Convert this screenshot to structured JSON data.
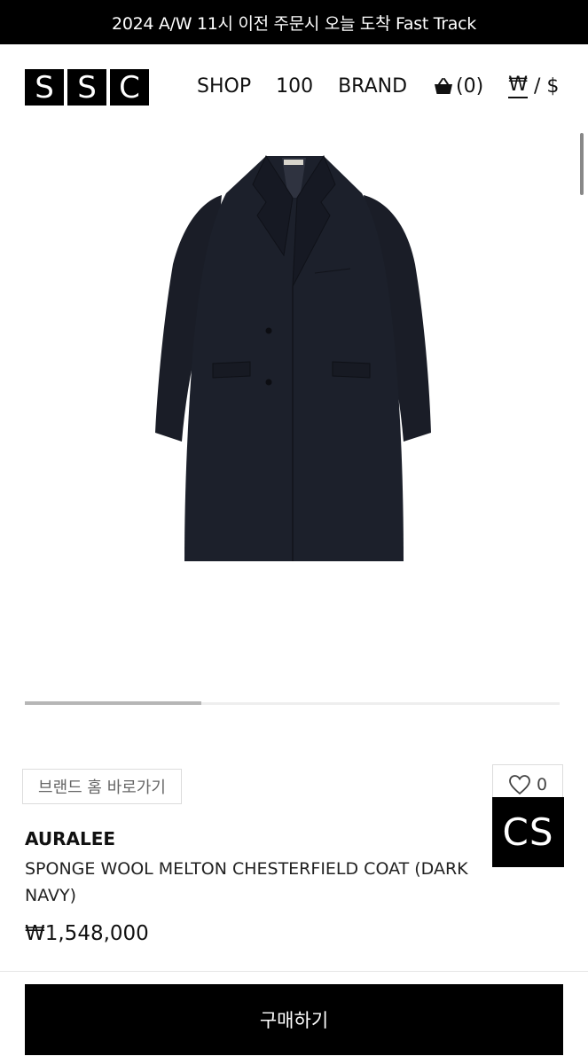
{
  "announcement": {
    "text": "2024 A/W 11시 이전 주문시 오늘 도착 Fast Track"
  },
  "header": {
    "logo_letters": [
      "S",
      "S",
      "C"
    ],
    "nav": {
      "shop": "SHOP",
      "hundred": "100",
      "brand": "BRAND"
    },
    "cart_count": "(0)",
    "cart_icon": "shopping-basket-icon",
    "currency_won": "₩",
    "currency_sep": " / ",
    "currency_dollar": "$"
  },
  "gallery": {
    "image_desc_icon": "coat-image",
    "slide_progress": 0.33
  },
  "actions": {
    "brand_home_label": "브랜드 홈 바로가기",
    "like_count": "0",
    "like_icon": "heart-outline-icon",
    "cs_label": "CS"
  },
  "product": {
    "brand": "AURALEE",
    "name_line1": "SPONGE WOOL MELTON CHESTERFIELD COAT (DARK",
    "name_line2": "NAVY)",
    "price": "₩1,548,000"
  },
  "buy": {
    "label": "구매하기"
  },
  "colors": {
    "announcement_bg": "#000000",
    "buy_bg": "#000000",
    "coat": "#1b1f2a"
  }
}
